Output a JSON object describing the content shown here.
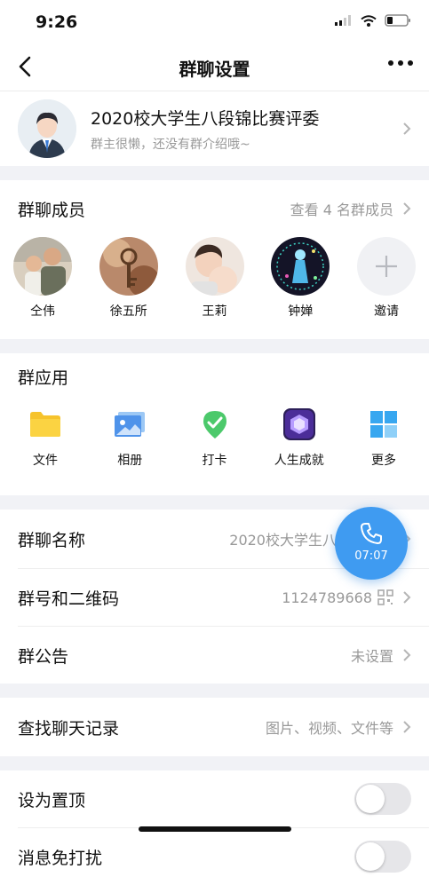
{
  "status": {
    "time": "9:26"
  },
  "nav": {
    "title": "群聊设置"
  },
  "group": {
    "title": "2020校大学生八段锦比赛评委",
    "intro": "群主很懒，还没有群介绍哦~"
  },
  "members": {
    "label": "群聊成员",
    "view_all": "查看 4 名群成员",
    "items": [
      {
        "name": "仝伟"
      },
      {
        "name": "徐五所"
      },
      {
        "name": "王莉"
      },
      {
        "name": "钟婵"
      }
    ],
    "invite": "邀请"
  },
  "apps": {
    "label": "群应用",
    "items": [
      {
        "name": "文件",
        "icon": "folder-icon"
      },
      {
        "name": "相册",
        "icon": "album-icon"
      },
      {
        "name": "打卡",
        "icon": "checkin-icon"
      },
      {
        "name": "人生成就",
        "icon": "achievement-icon"
      },
      {
        "name": "更多",
        "icon": "more-apps-icon"
      }
    ]
  },
  "info": {
    "name_label": "群聊名称",
    "name_value": "2020校大学生八段锦比赛",
    "number_label": "群号和二维码",
    "number_value": "1124789668",
    "notice_label": "群公告",
    "notice_value": "未设置"
  },
  "search": {
    "label": "查找聊天记录",
    "value": "图片、视频、文件等"
  },
  "settings": {
    "pin_label": "设为置顶",
    "mute_label": "消息免打扰",
    "pin_on": false,
    "mute_on": false
  },
  "call": {
    "duration": "07:07"
  },
  "colors": {
    "accent": "#3f9bf1",
    "checkin": "#4cc96b"
  }
}
